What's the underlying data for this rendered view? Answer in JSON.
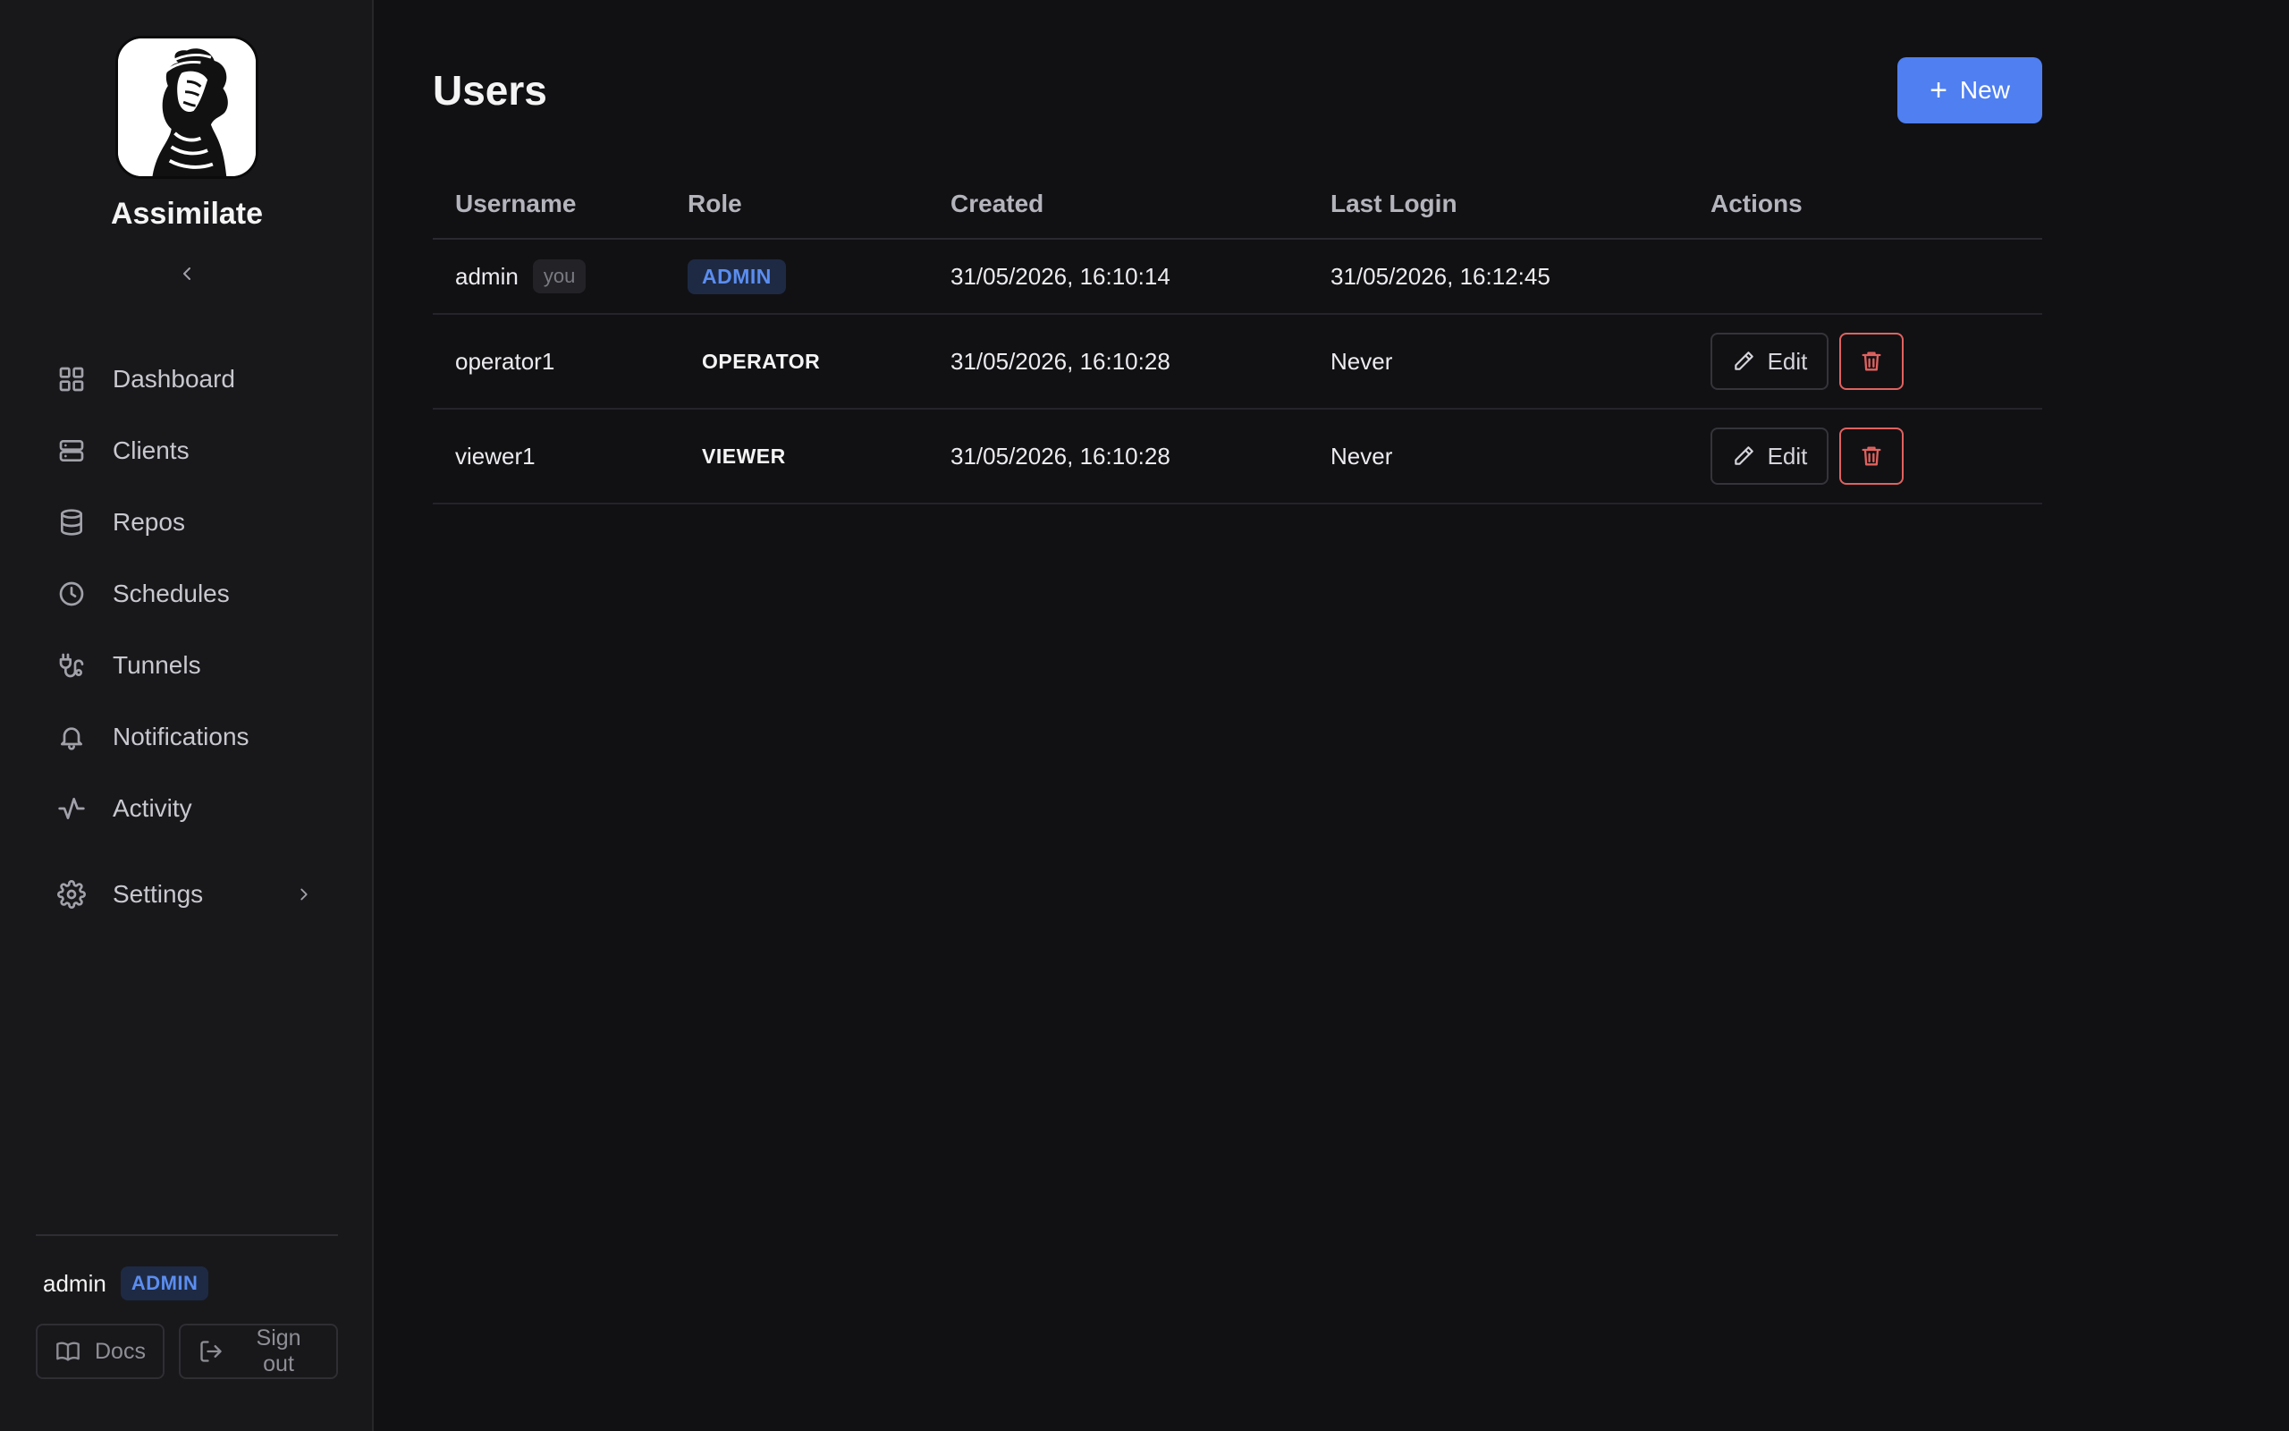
{
  "app": {
    "name": "Assimilate"
  },
  "sidebar": {
    "items": [
      {
        "label": "Dashboard"
      },
      {
        "label": "Clients"
      },
      {
        "label": "Repos"
      },
      {
        "label": "Schedules"
      },
      {
        "label": "Tunnels"
      },
      {
        "label": "Notifications"
      },
      {
        "label": "Activity"
      },
      {
        "label": "Settings"
      }
    ],
    "footer": {
      "username": "admin",
      "role": "ADMIN",
      "docs_label": "Docs",
      "signout_label": "Sign out"
    }
  },
  "page": {
    "title": "Users",
    "new_label": "New"
  },
  "table": {
    "columns": [
      "Username",
      "Role",
      "Created",
      "Last Login",
      "Actions"
    ],
    "you_label": "you",
    "edit_label": "Edit",
    "rows": [
      {
        "username": "admin",
        "role": "ADMIN",
        "created": "31/05/2026, 16:10:14",
        "last_login": "31/05/2026, 16:12:45"
      },
      {
        "username": "operator1",
        "role": "OPERATOR",
        "created": "31/05/2026, 16:10:28",
        "last_login": "Never"
      },
      {
        "username": "viewer1",
        "role": "VIEWER",
        "created": "31/05/2026, 16:10:28",
        "last_login": "Never"
      }
    ]
  },
  "colors": {
    "accent": "#4f7ff0",
    "danger": "#e0625f",
    "admin_badge_bg": "#1e2a44",
    "admin_badge_text": "#5b8def"
  }
}
